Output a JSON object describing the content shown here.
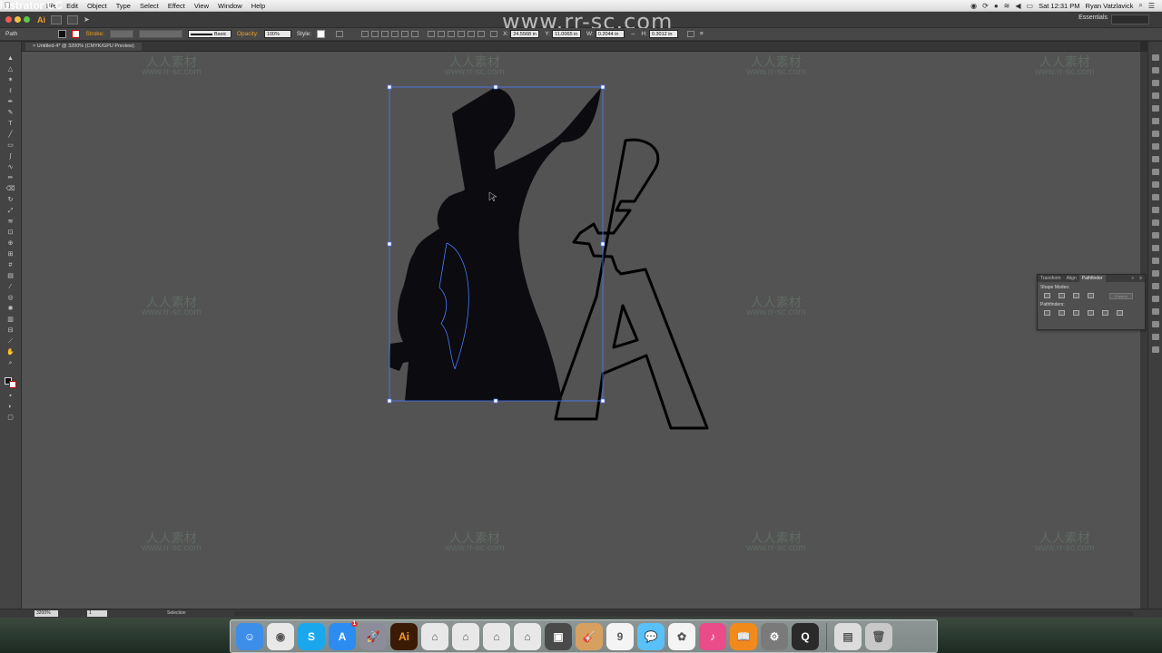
{
  "menubar": {
    "apple": "",
    "app_name": "Illustrator CC",
    "items": [
      "File",
      "Edit",
      "Object",
      "Type",
      "Select",
      "Effect",
      "View",
      "Window",
      "Help"
    ],
    "clock": "Sat 12:31 PM",
    "user": "Ryan Vatzlavick"
  },
  "appbar": {
    "logo": "Ai",
    "watermark_url": "www.rr-sc.com",
    "workspace": "Essentials"
  },
  "controlbar": {
    "selection_type": "Path",
    "stroke_label": "Stroke:",
    "brush_label": "Basic",
    "opacity_label": "Opacity:",
    "opacity_value": "100%",
    "style_label": "Style:",
    "x_value": "24.5568 in",
    "y_value": "11.0065 in",
    "w_value": "0.2044 in",
    "h_value": "0.3012 in"
  },
  "document": {
    "tab_title": "Untitled-4* @ 3200% (CMYK/GPU Preview)"
  },
  "watermark": {
    "cn": "人人素材",
    "url": "www.rr-sc.com"
  },
  "pathfinder": {
    "tabs": [
      "Transform",
      "Align",
      "Pathfinder"
    ],
    "active_tab": "Pathfinder",
    "shape_modes_label": "Shape Modes:",
    "pathfinders_label": "Pathfinders:",
    "expand_label": "Expand"
  },
  "status": {
    "zoom": "3200%",
    "page": "1",
    "tool": "Selection"
  },
  "dock": {
    "apps": [
      {
        "name": "Finder",
        "color": "#3d8ee8",
        "glyph": "☺"
      },
      {
        "name": "Chrome",
        "color": "#e8e8e8",
        "glyph": "◉"
      },
      {
        "name": "Skype",
        "color": "#1aa7ec",
        "glyph": "S"
      },
      {
        "name": "App Store",
        "color": "#2d8cf0",
        "glyph": "A",
        "badge": "1"
      },
      {
        "name": "Launchpad",
        "color": "#8c8c9a",
        "glyph": "🚀"
      },
      {
        "name": "Illustrator",
        "color": "#3b1a06",
        "glyph": "Ai"
      },
      {
        "name": "Doc 1",
        "color": "#e8e8e8",
        "glyph": "⌂"
      },
      {
        "name": "Doc 2",
        "color": "#e8e8e8",
        "glyph": "⌂"
      },
      {
        "name": "Doc 3",
        "color": "#e8e8e8",
        "glyph": "⌂"
      },
      {
        "name": "Doc 4",
        "color": "#e8e8e8",
        "glyph": "⌂"
      },
      {
        "name": "Photo Booth",
        "color": "#4a4a4a",
        "glyph": "▣"
      },
      {
        "name": "GarageBand",
        "color": "#d8a060",
        "glyph": "🎸"
      },
      {
        "name": "Calendar",
        "color": "#f4f4f4",
        "glyph": "9"
      },
      {
        "name": "Messages",
        "color": "#5ac0f8",
        "glyph": "💬"
      },
      {
        "name": "Photos",
        "color": "#f4f4f4",
        "glyph": "✿"
      },
      {
        "name": "iTunes",
        "color": "#ea4c89",
        "glyph": "♪"
      },
      {
        "name": "iBooks",
        "color": "#f08a1c",
        "glyph": "📖"
      },
      {
        "name": "System Preferences",
        "color": "#7a7a7a",
        "glyph": "⚙"
      },
      {
        "name": "QuickTime",
        "color": "#2a2a2a",
        "glyph": "Q"
      },
      {
        "name": "Documents",
        "color": "#dcdcdc",
        "glyph": "▤"
      },
      {
        "name": "Trash",
        "color": "#c8c8c8",
        "glyph": "🗑"
      }
    ]
  },
  "colors": {
    "canvas": "#535353",
    "selection": "#4a7cff",
    "fill": "#0b0b10"
  }
}
